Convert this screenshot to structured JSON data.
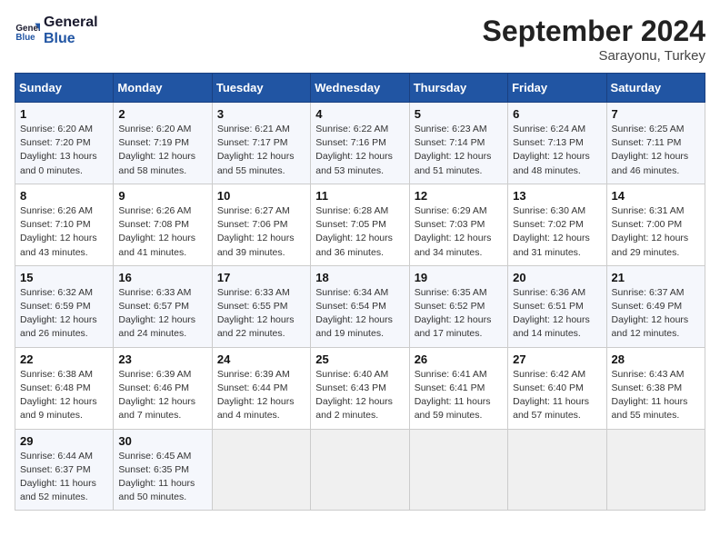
{
  "header": {
    "logo_line1": "General",
    "logo_line2": "Blue",
    "month": "September 2024",
    "location": "Sarayonu, Turkey"
  },
  "weekdays": [
    "Sunday",
    "Monday",
    "Tuesday",
    "Wednesday",
    "Thursday",
    "Friday",
    "Saturday"
  ],
  "weeks": [
    [
      {
        "day": "1",
        "detail": "Sunrise: 6:20 AM\nSunset: 7:20 PM\nDaylight: 13 hours\nand 0 minutes."
      },
      {
        "day": "2",
        "detail": "Sunrise: 6:20 AM\nSunset: 7:19 PM\nDaylight: 12 hours\nand 58 minutes."
      },
      {
        "day": "3",
        "detail": "Sunrise: 6:21 AM\nSunset: 7:17 PM\nDaylight: 12 hours\nand 55 minutes."
      },
      {
        "day": "4",
        "detail": "Sunrise: 6:22 AM\nSunset: 7:16 PM\nDaylight: 12 hours\nand 53 minutes."
      },
      {
        "day": "5",
        "detail": "Sunrise: 6:23 AM\nSunset: 7:14 PM\nDaylight: 12 hours\nand 51 minutes."
      },
      {
        "day": "6",
        "detail": "Sunrise: 6:24 AM\nSunset: 7:13 PM\nDaylight: 12 hours\nand 48 minutes."
      },
      {
        "day": "7",
        "detail": "Sunrise: 6:25 AM\nSunset: 7:11 PM\nDaylight: 12 hours\nand 46 minutes."
      }
    ],
    [
      {
        "day": "8",
        "detail": "Sunrise: 6:26 AM\nSunset: 7:10 PM\nDaylight: 12 hours\nand 43 minutes."
      },
      {
        "day": "9",
        "detail": "Sunrise: 6:26 AM\nSunset: 7:08 PM\nDaylight: 12 hours\nand 41 minutes."
      },
      {
        "day": "10",
        "detail": "Sunrise: 6:27 AM\nSunset: 7:06 PM\nDaylight: 12 hours\nand 39 minutes."
      },
      {
        "day": "11",
        "detail": "Sunrise: 6:28 AM\nSunset: 7:05 PM\nDaylight: 12 hours\nand 36 minutes."
      },
      {
        "day": "12",
        "detail": "Sunrise: 6:29 AM\nSunset: 7:03 PM\nDaylight: 12 hours\nand 34 minutes."
      },
      {
        "day": "13",
        "detail": "Sunrise: 6:30 AM\nSunset: 7:02 PM\nDaylight: 12 hours\nand 31 minutes."
      },
      {
        "day": "14",
        "detail": "Sunrise: 6:31 AM\nSunset: 7:00 PM\nDaylight: 12 hours\nand 29 minutes."
      }
    ],
    [
      {
        "day": "15",
        "detail": "Sunrise: 6:32 AM\nSunset: 6:59 PM\nDaylight: 12 hours\nand 26 minutes."
      },
      {
        "day": "16",
        "detail": "Sunrise: 6:33 AM\nSunset: 6:57 PM\nDaylight: 12 hours\nand 24 minutes."
      },
      {
        "day": "17",
        "detail": "Sunrise: 6:33 AM\nSunset: 6:55 PM\nDaylight: 12 hours\nand 22 minutes."
      },
      {
        "day": "18",
        "detail": "Sunrise: 6:34 AM\nSunset: 6:54 PM\nDaylight: 12 hours\nand 19 minutes."
      },
      {
        "day": "19",
        "detail": "Sunrise: 6:35 AM\nSunset: 6:52 PM\nDaylight: 12 hours\nand 17 minutes."
      },
      {
        "day": "20",
        "detail": "Sunrise: 6:36 AM\nSunset: 6:51 PM\nDaylight: 12 hours\nand 14 minutes."
      },
      {
        "day": "21",
        "detail": "Sunrise: 6:37 AM\nSunset: 6:49 PM\nDaylight: 12 hours\nand 12 minutes."
      }
    ],
    [
      {
        "day": "22",
        "detail": "Sunrise: 6:38 AM\nSunset: 6:48 PM\nDaylight: 12 hours\nand 9 minutes."
      },
      {
        "day": "23",
        "detail": "Sunrise: 6:39 AM\nSunset: 6:46 PM\nDaylight: 12 hours\nand 7 minutes."
      },
      {
        "day": "24",
        "detail": "Sunrise: 6:39 AM\nSunset: 6:44 PM\nDaylight: 12 hours\nand 4 minutes."
      },
      {
        "day": "25",
        "detail": "Sunrise: 6:40 AM\nSunset: 6:43 PM\nDaylight: 12 hours\nand 2 minutes."
      },
      {
        "day": "26",
        "detail": "Sunrise: 6:41 AM\nSunset: 6:41 PM\nDaylight: 11 hours\nand 59 minutes."
      },
      {
        "day": "27",
        "detail": "Sunrise: 6:42 AM\nSunset: 6:40 PM\nDaylight: 11 hours\nand 57 minutes."
      },
      {
        "day": "28",
        "detail": "Sunrise: 6:43 AM\nSunset: 6:38 PM\nDaylight: 11 hours\nand 55 minutes."
      }
    ],
    [
      {
        "day": "29",
        "detail": "Sunrise: 6:44 AM\nSunset: 6:37 PM\nDaylight: 11 hours\nand 52 minutes."
      },
      {
        "day": "30",
        "detail": "Sunrise: 6:45 AM\nSunset: 6:35 PM\nDaylight: 11 hours\nand 50 minutes."
      },
      {
        "day": "",
        "detail": ""
      },
      {
        "day": "",
        "detail": ""
      },
      {
        "day": "",
        "detail": ""
      },
      {
        "day": "",
        "detail": ""
      },
      {
        "day": "",
        "detail": ""
      }
    ]
  ]
}
